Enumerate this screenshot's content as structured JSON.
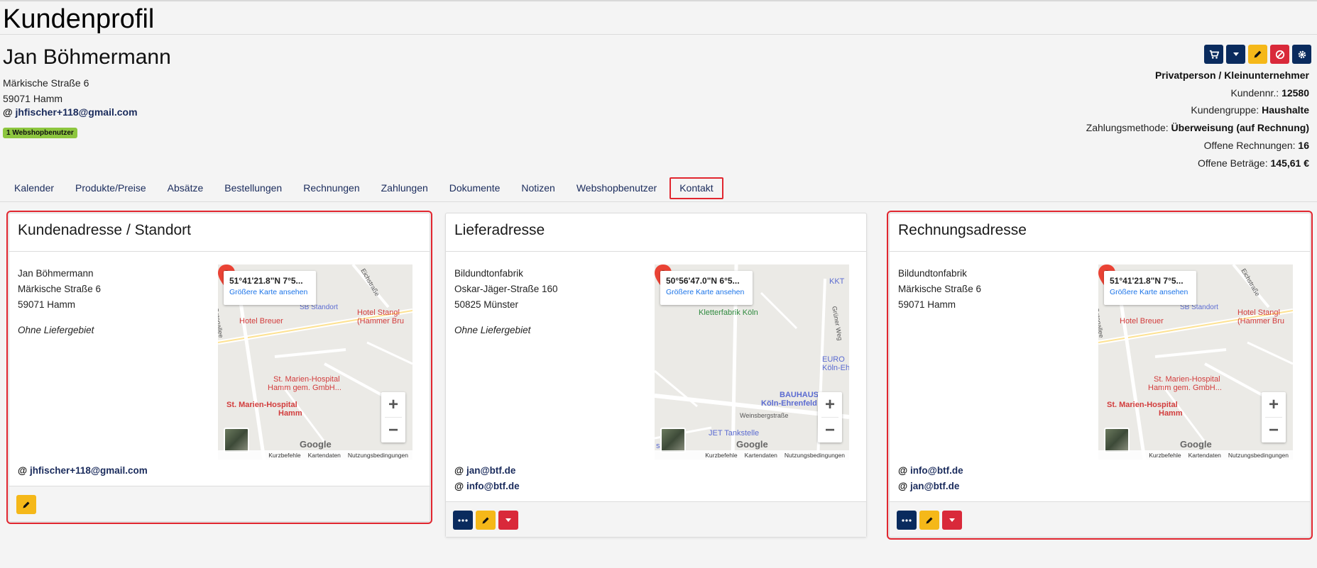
{
  "page": {
    "title": "Kundenprofil"
  },
  "customer": {
    "name": "Jan Böhmermann",
    "street": "Märkische Straße 6",
    "city": "59071 Hamm",
    "email_prefix": "@",
    "email": "jhfischer+118@gmail.com",
    "badge": "1 Webshopbenutzer"
  },
  "meta": {
    "type": "Privatperson / Kleinunternehmer",
    "kundennr_label": "Kundennr.:",
    "kundennr_value": "12580",
    "gruppe_label": "Kundengruppe:",
    "gruppe_value": "Haushalte",
    "zahlung_label": "Zahlungsmethode:",
    "zahlung_value": "Überweisung (auf Rechnung)",
    "rechnungen_label": "Offene Rechnungen:",
    "rechnungen_value": "16",
    "betraege_label": "Offene Beträge:",
    "betraege_value": "145,61 €"
  },
  "tabs": [
    "Kalender",
    "Produkte/Preise",
    "Absätze",
    "Bestellungen",
    "Rechnungen",
    "Zahlungen",
    "Dokumente",
    "Notizen",
    "Webshopbenutzer",
    "Kontakt"
  ],
  "cards": {
    "kunde": {
      "title": "Kundenadresse / Standort",
      "line1": "Jan Böhmermann",
      "line2": "Märkische Straße 6",
      "line3": "59071 Hamm",
      "note": "Ohne Liefergebiet",
      "email1": "jhfischer+118@gmail.com",
      "map": {
        "coords": "51°41'21.8\"N 7°5...",
        "link": "Größere Karte ansehen",
        "labels": [
          "Hotel Breuer",
          "Hotel Stangl",
          "(Hammer Bru",
          "SB Standort",
          "St. Marien-Hospital",
          "Hamm gem. GmbH...",
          "St. Marien-Hospital",
          "Hamm",
          "Ostenallee",
          "Eichstraße"
        ]
      }
    },
    "liefer": {
      "title": "Lieferadresse",
      "line1": "Bildundtonfabrik",
      "line2": "Oskar-Jäger-Straße 160",
      "line3": "50825 Münster",
      "note": "Ohne Liefergebiet",
      "email1": "jan@btf.de",
      "email2": "info@btf.de",
      "map": {
        "coords": "50°56'47.0\"N 6°5...",
        "link": "Größere Karte ansehen",
        "labels": [
          "Kletterfabrik Köln",
          "KKT",
          "EURO",
          "Köln-Eh",
          "BAUHAUS",
          "Köln-Ehrenfeld",
          "Weinsbergstraße",
          "JET Tankstelle",
          "Grüner Weg",
          "seum"
        ]
      }
    },
    "rechnung": {
      "title": "Rechnungsadresse",
      "line1": "Bildundtonfabrik",
      "line2": "Märkische Straße 6",
      "line3": "59071 Hamm",
      "email1": "info@btf.de",
      "email2": "jan@btf.de",
      "map": {
        "coords": "51°41'21.8\"N 7°5...",
        "link": "Größere Karte ansehen",
        "labels": [
          "Hotel Breuer",
          "Hotel Stangl",
          "(Hammer Bru",
          "SB Standort",
          "St. Marien-Hospital",
          "Hamm gem. GmbH...",
          "St. Marien-Hospital",
          "Hamm",
          "Ostenallee",
          "Eichstraße"
        ]
      }
    }
  },
  "map_common": {
    "google": "Google",
    "kurzbefehle": "Kurzbefehle",
    "kartendaten": "Kartendaten",
    "nutzung": "Nutzungsbedingungen",
    "zoom_in": "+",
    "zoom_out": "−"
  },
  "icons": [
    "cart-icon",
    "caret-down-icon",
    "pencil-icon",
    "ban-icon",
    "gear-icon",
    "dots-icon",
    "location-pin-icon"
  ],
  "colors": {
    "navy": "#0a2b5e",
    "yellow": "#f5b819",
    "red": "#d9293a",
    "highlight": "#e1262f",
    "badge": "#8dc63f"
  }
}
